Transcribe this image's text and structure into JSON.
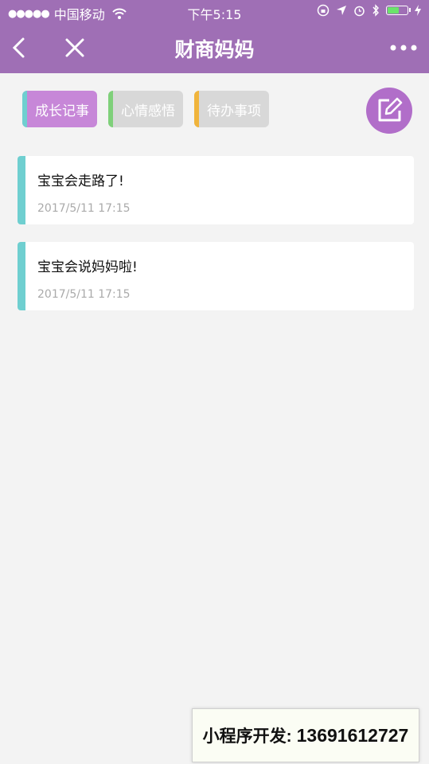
{
  "status_bar": {
    "signal_dots": "●●●●●",
    "carrier": "中国移动",
    "time": "下午5:15",
    "battery_level": 0.6,
    "battery_color": "#6be36b"
  },
  "nav": {
    "title": "财商妈妈",
    "back_icon": "chevron-left-icon",
    "close_icon": "close-icon",
    "more_icon": "more-icon",
    "bar_color": "#9f6fb5"
  },
  "tabs": [
    {
      "label": "成长记事",
      "active": true,
      "accent": "#6fcfd0"
    },
    {
      "label": "心情感悟",
      "active": false,
      "accent": "#7fd07a"
    },
    {
      "label": "待办事项",
      "active": false,
      "accent": "#f0b43c"
    }
  ],
  "compose_icon": "edit-icon",
  "entries": [
    {
      "title": "宝宝会走路了!",
      "date": "2017/5/11 17:15"
    },
    {
      "title": "宝宝会说妈妈啦!",
      "date": "2017/5/11 17:15"
    }
  ],
  "promo": {
    "label": "小程序开发:",
    "number": "13691612727"
  }
}
